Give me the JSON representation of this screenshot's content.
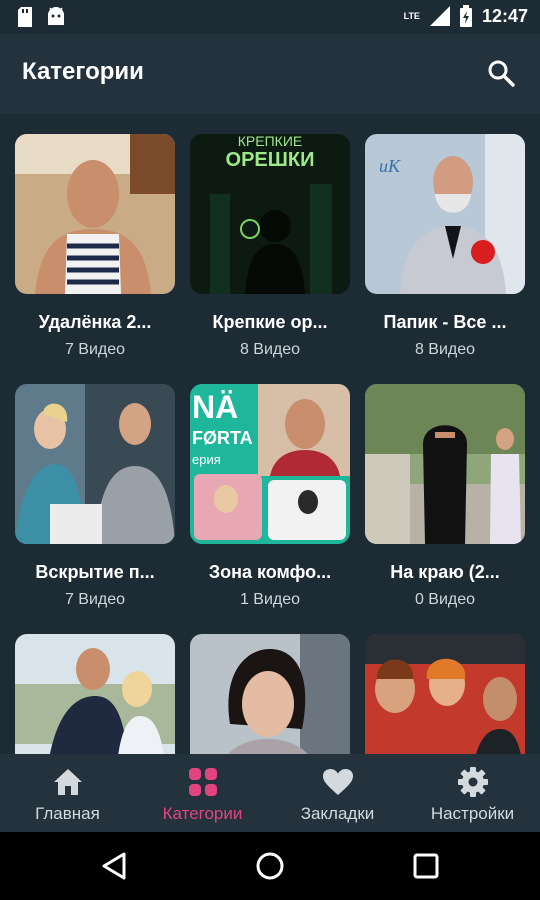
{
  "status_bar": {
    "time": "12:47",
    "network": "LTE"
  },
  "header": {
    "title": "Категории",
    "search_icon": "search-icon"
  },
  "categories": [
    {
      "title": "Удалёнка  2...",
      "count": "7 Видео"
    },
    {
      "title": "Крепкие ор...",
      "count": "8 Видео",
      "poster_text": [
        "КРЕПКИЕ",
        "ОРЕШКИ"
      ]
    },
    {
      "title": "Папик - Все ...",
      "count": "8 Видео",
      "poster_text": "иК"
    },
    {
      "title": "Вскрытие п...",
      "count": "7 Видео"
    },
    {
      "title": "Зона комфо...",
      "count": "1 Видео",
      "poster_text": [
        "NÄ",
        "FØRTA",
        "ерия"
      ]
    },
    {
      "title": "На краю  (2...",
      "count": "0 Видео"
    },
    {
      "title": "",
      "count": ""
    },
    {
      "title": "",
      "count": ""
    },
    {
      "title": "",
      "count": ""
    }
  ],
  "bottom_nav": [
    {
      "label": "Главная",
      "icon": "home-icon"
    },
    {
      "label": "Категории",
      "icon": "grid-icon",
      "active": true
    },
    {
      "label": "Закладки",
      "icon": "heart-icon"
    },
    {
      "label": "Настройки",
      "icon": "gear-icon"
    }
  ],
  "colors": {
    "background": "#1d2b34",
    "bar": "#23323c",
    "accent": "#e0457f"
  }
}
